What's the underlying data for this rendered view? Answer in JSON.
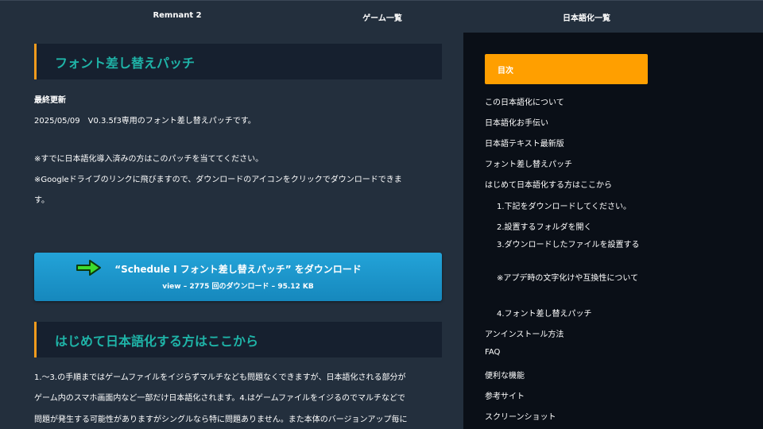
{
  "nav": {
    "item1": "Remnant 2",
    "item2": "ゲーム一覧",
    "item3": "日本語化一覧"
  },
  "section1": {
    "title": "フォント差し替えパッチ",
    "updated_label": "最終更新",
    "updated_text": "2025/05/09　V0.3.5f3専用のフォント差し替えパッチです。",
    "note1": "※すでに日本語化導入済みの方はこのパッチを当ててください。",
    "note2_line1": "※Googleドライブのリンクに飛びますので、ダウンロードのアイコンをクリックでダウンロードできま",
    "note2_line2": "す。"
  },
  "download": {
    "label": "“Schedule I フォント差し替えパッチ” をダウンロード",
    "meta": "view – 2775 回のダウンロード – 95.12 KB",
    "arrow_icon": "green-arrow-icon"
  },
  "section2": {
    "title": "はじめて日本語化する方はここから",
    "p1": "1.～3.の手順まではゲームファイルをイジらずマルチなども問題なくできますが、日本語化される部分が",
    "p2": "ゲーム内のスマホ画面内など一部だけ日本語化されます。4.はゲームファイルをイジるのでマルチなどで",
    "p3": "問題が発生する可能性がありますがシングルなら特に問題ありません。また本体のバージョンアップ毎に"
  },
  "toc": {
    "title": "目次",
    "items": [
      "この日本語化について",
      "日本語化お手伝い",
      "日本語テキスト最新版",
      "フォント差し替えパッチ",
      "はじめて日本語化する方はここから",
      "1.下記をダウンロードしてください。",
      "2.設置するフォルダを開く",
      "3.ダウンロードしたファイルを設置する",
      "※アプデ時の文字化けや互換性について",
      "4.フォント差し替えパッチ",
      "アンインストール方法",
      "FAQ",
      "便利な機能",
      "参考サイト",
      "スクリーンショット"
    ]
  },
  "colors": {
    "accent": "#f29b1d",
    "heading": "#1fb4a8",
    "toc_header": "#ff9f00",
    "button": "#1a96cc"
  }
}
